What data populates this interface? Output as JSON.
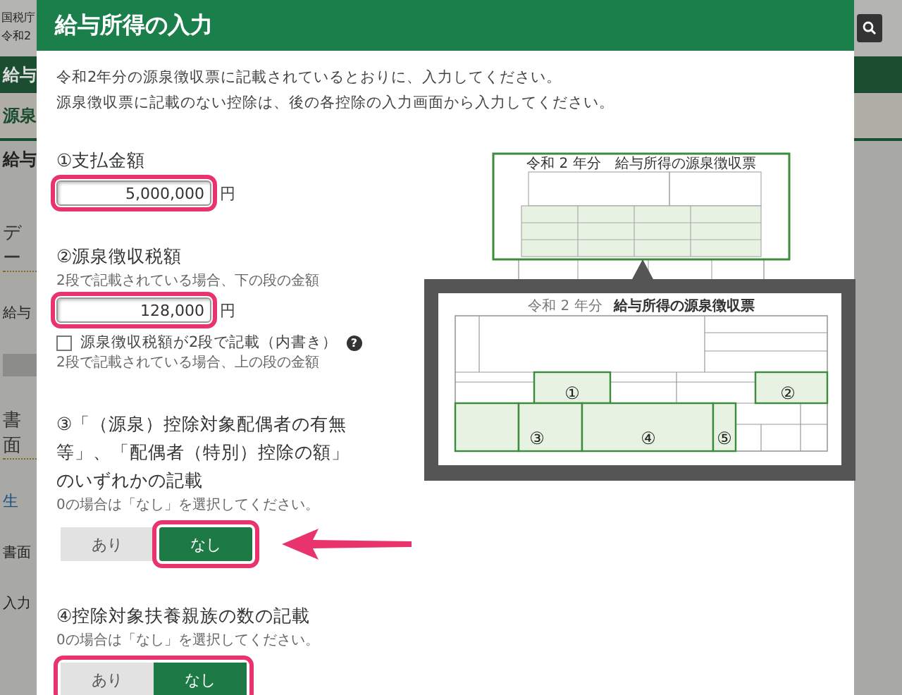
{
  "background_page": {
    "header_lines": [
      "国税庁",
      "令和2"
    ],
    "band_title": "給与",
    "section_title": "源泉",
    "page_title": "給与",
    "side_texts": [
      {
        "kind": "heading",
        "text": "デー"
      },
      {
        "kind": "small",
        "text": "給与"
      },
      {
        "kind": "box"
      },
      {
        "kind": "heading",
        "text": "書面"
      },
      {
        "kind": "link",
        "text": "生"
      },
      {
        "kind": "small",
        "text": "書面"
      },
      {
        "kind": "small",
        "text": "入力"
      }
    ]
  },
  "dialog": {
    "title": "給与所得の入力",
    "intro": [
      "令和2年分の源泉徴収票に記載されているとおりに、入力してください。",
      "源泉徴収票に記載のない控除は、後の各控除の入力画面から入力してください。"
    ],
    "items": [
      {
        "kind": "amount",
        "label": "①支払金額",
        "value": "5,000,000",
        "unit": "円",
        "highlighted": true
      },
      {
        "kind": "amount",
        "label": "②源泉徴収税額",
        "hint": "2段で記載されている場合、下の段の金額",
        "value": "128,000",
        "unit": "円",
        "highlighted": true,
        "checkbox": {
          "label": "源泉徴収税額が2段で記載（内書き）",
          "checked": false,
          "help": "?",
          "hint": "2段で記載されている場合、上の段の金額"
        }
      },
      {
        "kind": "choice",
        "label": "③「（源泉）控除対象配偶者の有無等」、「配偶者（特別）控除の額」のいずれかの記載",
        "hint": "0の場合は「なし」を選択してください。",
        "options": [
          {
            "label": "あり",
            "selected": false,
            "highlighted": false
          },
          {
            "label": "なし",
            "selected": true,
            "highlighted": true
          }
        ],
        "arrow": true
      },
      {
        "kind": "choice",
        "label": "④控除対象扶養親族の数の記載",
        "hint": "0の場合は「なし」を選択してください。",
        "options": [
          {
            "label": "あり",
            "selected": false,
            "highlighted": false
          },
          {
            "label": "なし",
            "selected": true,
            "highlighted": false
          }
        ],
        "group_highlighted": true
      }
    ]
  },
  "slip_illustration": {
    "small_title": "令和 2 年分　給与所得の源泉徴収票",
    "large_title_year": "令和 2 年分",
    "large_title": "給与所得の源泉徴収票",
    "markers": [
      "①",
      "②",
      "③",
      "④",
      "⑤"
    ]
  }
}
